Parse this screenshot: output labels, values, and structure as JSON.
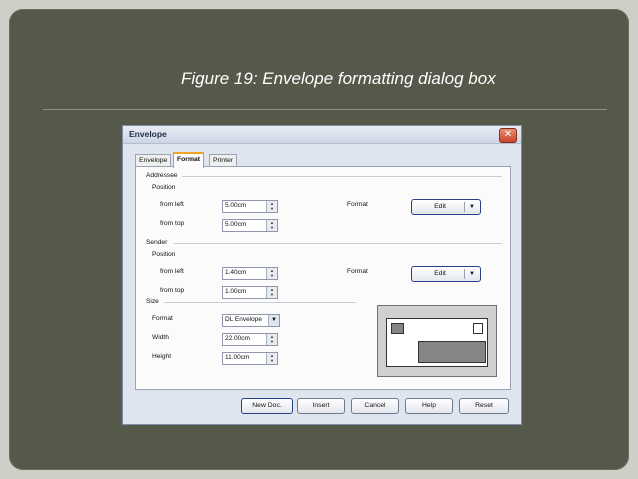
{
  "slide": {
    "caption": "Figure 19: Envelope formatting dialog box"
  },
  "dialog": {
    "title": "Envelope",
    "close_glyph": "✕",
    "tabs": [
      {
        "label": "Envelope",
        "active": false
      },
      {
        "label": "Format",
        "active": true
      },
      {
        "label": "Printer",
        "active": false
      }
    ],
    "addressee": {
      "section_label": "Addressee",
      "position_label": "Position",
      "from_left_label": "from left",
      "from_left_value": "5.00cm",
      "from_top_label": "from top",
      "from_top_value": "5.00cm",
      "format_label": "Format",
      "edit_label": "Edit"
    },
    "sender": {
      "section_label": "Sender",
      "position_label": "Position",
      "from_left_label": "from left",
      "from_left_value": "1.40cm",
      "from_top_label": "from top",
      "from_top_value": "1.00cm",
      "format_label": "Format",
      "edit_label": "Edit"
    },
    "size": {
      "section_label": "Size",
      "format_label": "Format",
      "format_value": "DL Envelope",
      "width_label": "Width",
      "width_value": "22.00cm",
      "height_label": "Height",
      "height_value": "11.00cm"
    },
    "buttons": {
      "new_doc": "New Doc.",
      "insert": "Insert",
      "cancel": "Cancel",
      "help": "Help",
      "reset": "Reset"
    },
    "icons": {
      "spin": "spin-arrows-icon",
      "dropdown": "chevron-down-icon",
      "close": "close-icon"
    },
    "colors": {
      "slide_bg": "#55594a",
      "dialog_bg": "#dfe5ee",
      "active_tab_accent": "#f0a326",
      "close_button": "#c9452b"
    }
  }
}
